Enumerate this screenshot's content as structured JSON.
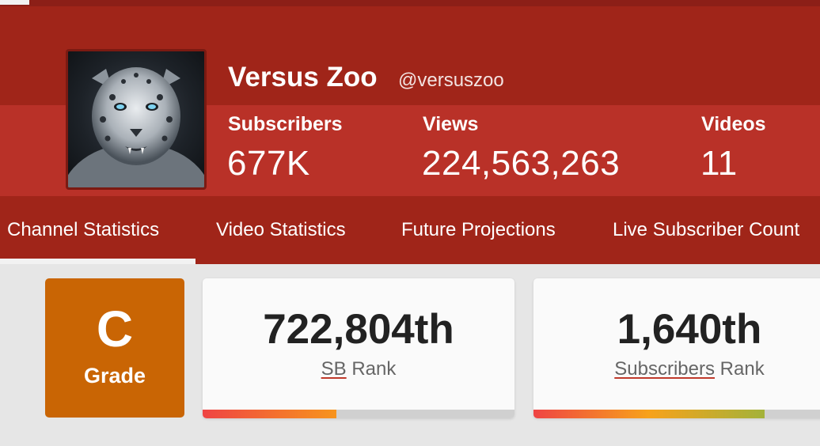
{
  "channel": {
    "name": "Versus Zoo",
    "handle": "@versuszoo"
  },
  "stats": [
    {
      "label": "Subscribers",
      "value": "677K"
    },
    {
      "label": "Views",
      "value": "224,563,263"
    },
    {
      "label": "Videos",
      "value": "11"
    }
  ],
  "nav": {
    "tabs": [
      {
        "label": "Channel Statistics",
        "active": true
      },
      {
        "label": "Video Statistics",
        "active": false
      },
      {
        "label": "Future Projections",
        "active": false
      },
      {
        "label": "Live Subscriber Count",
        "active": false
      }
    ]
  },
  "grade": {
    "letter": "C",
    "label": "Grade",
    "color": "#c96504"
  },
  "ranks": [
    {
      "value": "722,804th",
      "link": "SB",
      "suffix": " Rank",
      "progress": 0.43,
      "gradient": [
        "#ef4444",
        "#f7941d"
      ]
    },
    {
      "value": "1,640th",
      "link": "Subscribers",
      "suffix": " Rank",
      "progress": 0.74,
      "gradient": [
        "#ef4444",
        "#f7a21b",
        "#a3b23a"
      ]
    }
  ],
  "colors": {
    "header": "#a02519",
    "header_band": "#b93128",
    "page_bg": "#e6e6e6"
  },
  "icons": {
    "avatar": "snow-leopard-avatar"
  }
}
